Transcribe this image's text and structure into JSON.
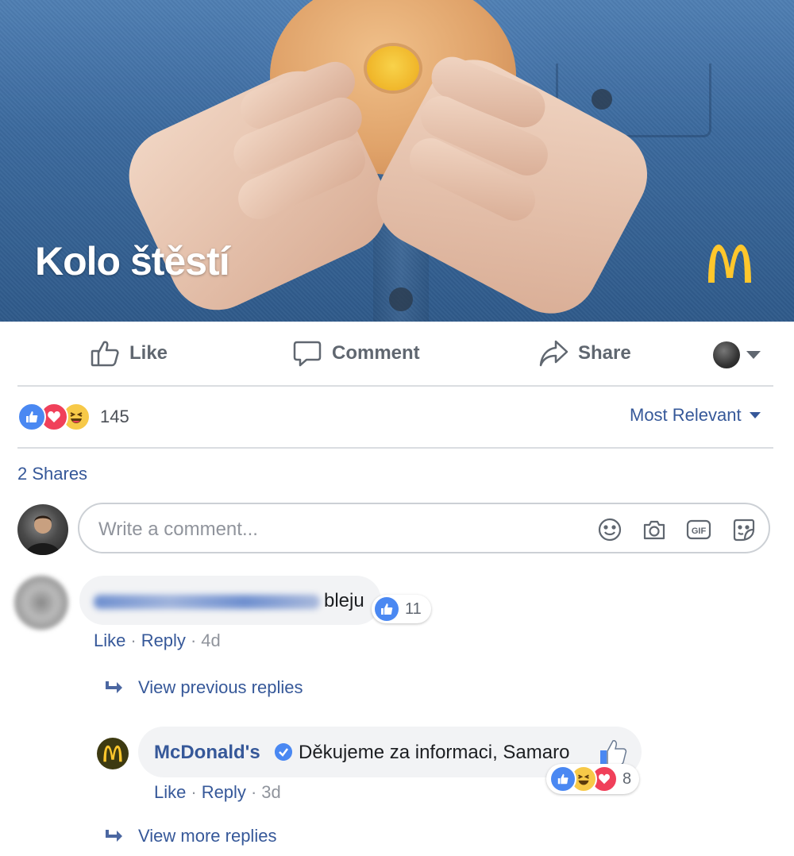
{
  "post": {
    "image_title": "Kolo štěstí",
    "brand_logo": "mcdonalds-arches-logo"
  },
  "actions": {
    "like_label": "Like",
    "comment_label": "Comment",
    "share_label": "Share"
  },
  "stats": {
    "reaction_count": "145",
    "reaction_types": [
      "like",
      "love",
      "haha"
    ],
    "sort_label": "Most Relevant",
    "shares_label": "2 Shares"
  },
  "composer": {
    "placeholder": "Write a comment...",
    "icons": [
      "emoji-icon",
      "camera-icon",
      "gif-icon",
      "sticker-icon"
    ]
  },
  "comments": [
    {
      "text": "bleju",
      "like_count": "11",
      "like_label": "Like",
      "reply_label": "Reply",
      "time": "4d"
    }
  ],
  "view_previous_replies": "View previous replies",
  "reply": {
    "author": "McDonald's",
    "text": "Děkujeme za informaci, Samaro",
    "reaction_count": "8",
    "like_label": "Like",
    "reply_label": "Reply",
    "time": "3d"
  },
  "view_more_replies": "View more replies",
  "colors": {
    "link": "#365899",
    "like_blue": "#4a88f2",
    "love_red": "#f0405a",
    "haha_yellow": "#f7c948",
    "mcd_yellow": "#ffc72c"
  }
}
